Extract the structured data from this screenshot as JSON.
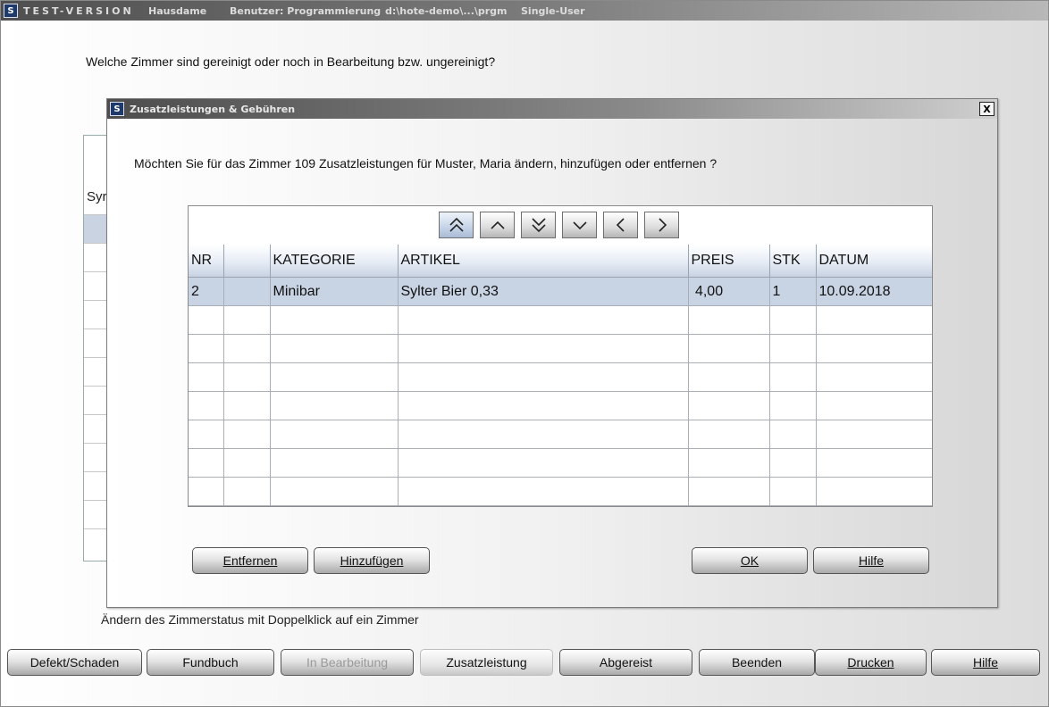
{
  "app": {
    "title_segments": [
      "TEST-VERSION",
      "Hausdame",
      "Benutzer: Programmierung",
      "d:\\hote-demo\\...\\prgm",
      "Single-User"
    ],
    "logo_glyph": "S"
  },
  "main": {
    "question": "Welche Zimmer sind gereinigt oder noch in Bearbeitung bzw. ungereinigt?",
    "bg_table_header_partial": "Syr",
    "hint": "Ändern des Zimmerstatus mit Doppelklick auf ein Zimmer"
  },
  "bottom_buttons": [
    {
      "label": "Defekt/Schaden",
      "disabled": false
    },
    {
      "label": "Fundbuch",
      "disabled": false
    },
    {
      "label": "In Bearbeitung",
      "disabled": true
    },
    {
      "label": "Zusatzleistung",
      "disabled": false
    },
    {
      "label": "Abgereist",
      "disabled": false
    },
    {
      "label": "Beenden",
      "disabled": false
    },
    {
      "label": "Drucken",
      "disabled": false
    },
    {
      "label": "Hilfe",
      "disabled": false
    }
  ],
  "dialog": {
    "title": "Zusatzleistungen & Gebühren",
    "close_glyph": "X",
    "question": "Möchten Sie für das Zimmer 109 Zusatzleistungen für Muster, Maria ändern, hinzufügen oder entfernen ?",
    "nav_icons": [
      "double-chevron-up-icon",
      "chevron-up-icon",
      "double-chevron-down-icon",
      "chevron-down-icon",
      "chevron-left-icon",
      "chevron-right-icon"
    ],
    "columns": [
      "NR",
      "",
      "KATEGORIE",
      "ARTIKEL",
      "PREIS",
      "STK",
      "DATUM"
    ],
    "rows": [
      [
        "2",
        "",
        "Minibar",
        "Sylter Bier 0,33",
        " 4,00",
        "1",
        "10.09.2018"
      ]
    ],
    "empty_rows": 7,
    "buttons": {
      "entfernen": "Entfernen",
      "hinzufuegen": "Hinzufügen",
      "ok": "OK",
      "hilfe": "Hilfe"
    },
    "colors": {
      "selected_row": "#c8d3e3",
      "header_gradient_end": "#c7d2e2"
    }
  }
}
